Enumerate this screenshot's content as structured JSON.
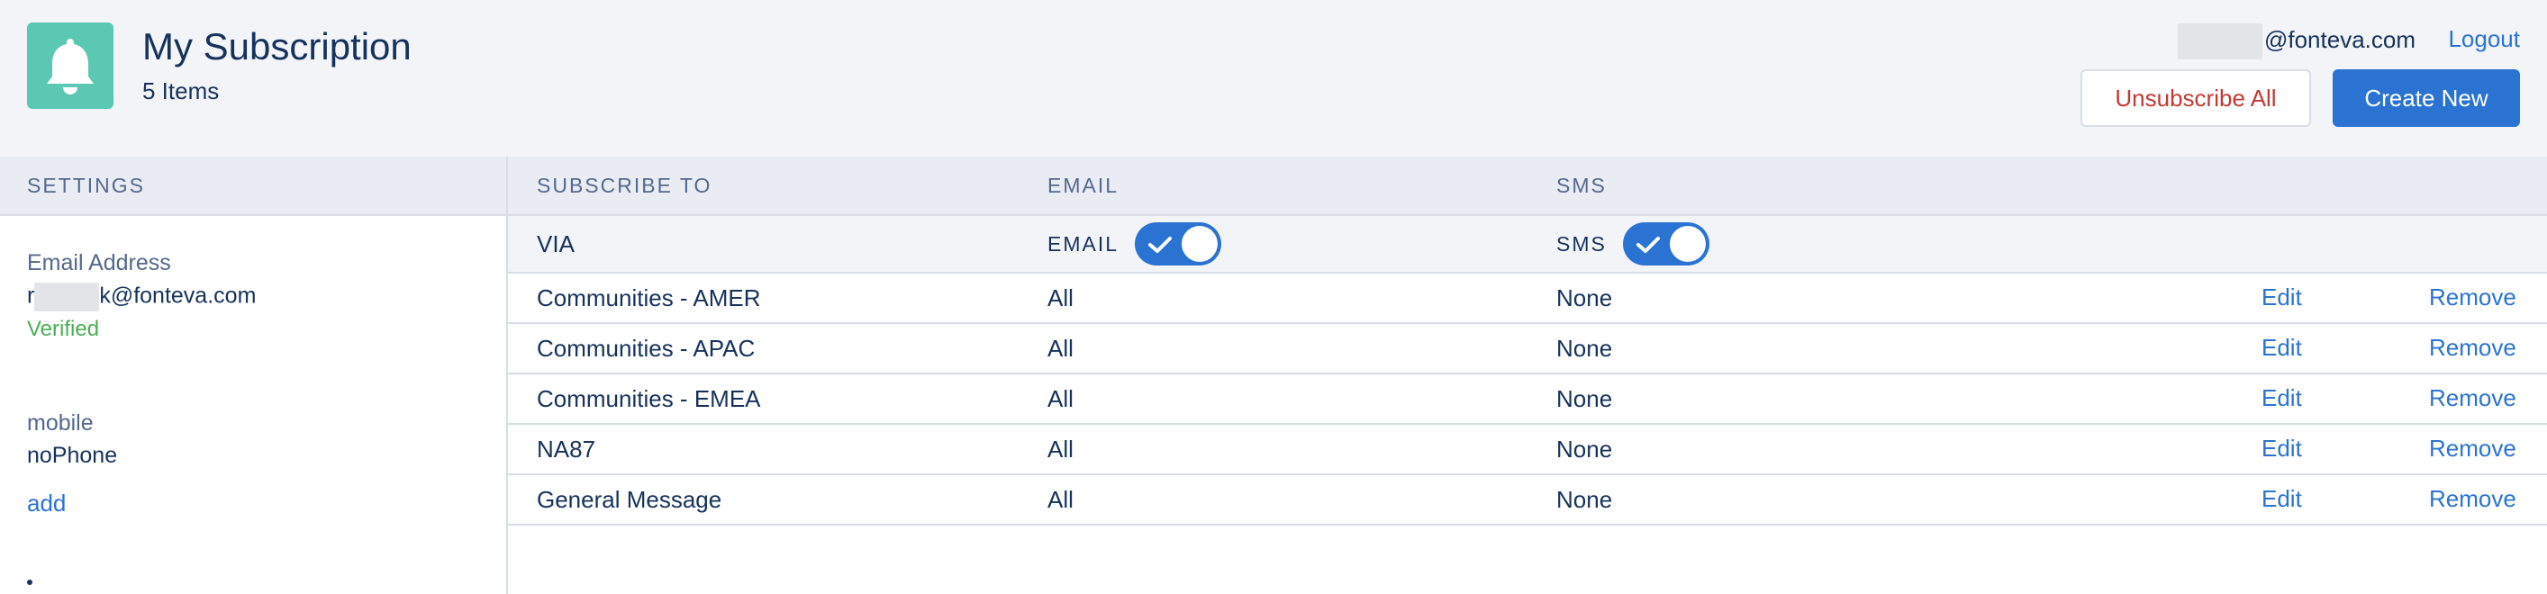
{
  "header": {
    "title": "My Subscription",
    "item_count": "5 Items",
    "user_email_domain": "@fonteva.com",
    "logout_label": "Logout",
    "unsubscribe_all_label": "Unsubscribe All",
    "create_new_label": "Create New",
    "logo_icon": "bell-icon"
  },
  "sidebar": {
    "heading": "SETTINGS",
    "email_label": "Email Address",
    "email_value_start": "r",
    "email_value_end": "k@fonteva.com",
    "email_status": "Verified",
    "mobile_label": "mobile",
    "mobile_value": "noPhone",
    "add_label": "add"
  },
  "table": {
    "columns": [
      "SUBSCRIBE TO",
      "EMAIL",
      "SMS"
    ],
    "via": {
      "label": "VIA",
      "email_label": "EMAIL",
      "email_enabled": true,
      "sms_label": "SMS",
      "sms_enabled": true
    },
    "rows": [
      {
        "name": "Communities - AMER",
        "email": "All",
        "sms": "None",
        "edit": "Edit",
        "remove": "Remove"
      },
      {
        "name": "Communities - APAC",
        "email": "All",
        "sms": "None",
        "edit": "Edit",
        "remove": "Remove"
      },
      {
        "name": "Communities - EMEA",
        "email": "All",
        "sms": "None",
        "edit": "Edit",
        "remove": "Remove"
      },
      {
        "name": "NA87",
        "email": "All",
        "sms": "None",
        "edit": "Edit",
        "remove": "Remove"
      },
      {
        "name": "General Message",
        "email": "All",
        "sms": "None",
        "edit": "Edit",
        "remove": "Remove"
      }
    ]
  },
  "colors": {
    "accent": "#2a73d2",
    "logo_bg": "#5bc8b4",
    "danger": "#c23934",
    "success": "#4bae55"
  }
}
